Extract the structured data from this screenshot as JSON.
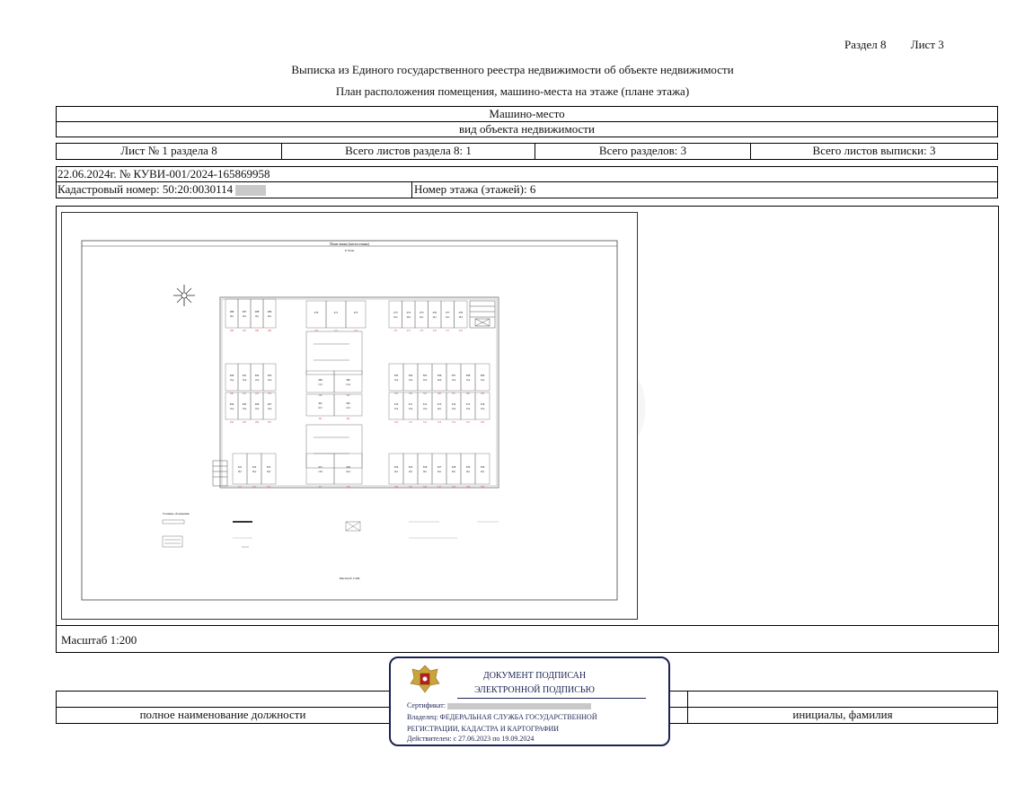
{
  "header": {
    "section": "Раздел 8",
    "sheet": "Лист 3",
    "title": "Выписка из Единого государственного реестра недвижимости об объекте недвижимости",
    "subtitle": "План расположения помещения, машино-места на этаже (плане этажа)"
  },
  "object": {
    "name": "Машино-место",
    "caption": "вид объекта недвижимости"
  },
  "sheets": {
    "sheet_no": "Лист № 1 раздела 8",
    "total_section_sheets": "Всего листов раздела 8: 1",
    "total_sections": "Всего разделов: 3",
    "total_extract_sheets": "Всего листов выписки: 3"
  },
  "record": {
    "date_number": "22.06.2024г. № КУВИ-001/2024-165869958",
    "cadastral_label": "Кадастровый номер: 50:20:0030114",
    "floor": "Номер этажа (этажей): 6"
  },
  "plan": {
    "sheet_title": "План этажа (части этажа)",
    "sheet_subtitle": "6 Этаж",
    "sheet_scale": "Масштаб 1:200",
    "legend_title": "Условные обозначения:",
    "top_left_ids": [
      "286",
      "287",
      "288",
      "289"
    ],
    "top_left_areas": [
      "16,1",
      "16,1",
      "16,1",
      "16,1"
    ],
    "top_mid_ids": [
      "270",
      "271",
      "272"
    ],
    "top_right_ids": [
      "273",
      "274",
      "275",
      "276",
      "277",
      "278"
    ],
    "top_right_areas": [
      "16,2",
      "16,2",
      "16,1",
      "16,1",
      "16,1",
      "16,2"
    ],
    "mid_left_ids": [
      "290",
      "291",
      "292",
      "293"
    ],
    "mid_left_areas": [
      "13,4",
      "13,4",
      "13,4",
      "13,4"
    ],
    "low_left_ids": [
      "294",
      "295",
      "296",
      "297"
    ],
    "low_left_areas": [
      "13,4",
      "13,4",
      "13,4",
      "13,4"
    ],
    "mid_center_ids": [
      "299",
      "300",
      "301",
      "302"
    ],
    "mid_center_areas": [
      "13,5",
      "15,4",
      "16,7",
      "13,5"
    ],
    "mid_right_ids": [
      "303",
      "304",
      "305",
      "306",
      "307",
      "308",
      "309"
    ],
    "mid_right_areas": [
      "15,4",
      "15,4",
      "15,4",
      "16,0",
      "15,4",
      "15,4",
      "15,4"
    ],
    "low_right_ids": [
      "310",
      "311",
      "312",
      "313",
      "314",
      "315",
      "316"
    ],
    "low_right_areas": [
      "15,4",
      "15,4",
      "15,4",
      "16,1",
      "15,4",
      "15,4",
      "15,4"
    ],
    "bottom_left_ids": [
      "321",
      "322",
      "323"
    ],
    "bottom_left_areas": [
      "16,7",
      "16,2",
      "16,2"
    ],
    "bottom_center_ids": [
      "317",
      "318"
    ],
    "bottom_center_areas": [
      "13,9",
      "16,4"
    ],
    "bottom_right_ids": [
      "324",
      "325",
      "326",
      "327",
      "328",
      "329",
      "330"
    ],
    "bottom_right_areas": [
      "16,1",
      "16,1",
      "16,1",
      "16,1",
      "16,1",
      "16,1",
      "16,1"
    ]
  },
  "scale": "Масштаб 1:200",
  "signature": {
    "position": "полное наименование должности",
    "name": "инициалы, фамилия"
  },
  "stamp": {
    "line1": "ДОКУМЕНТ ПОДПИСАН",
    "line2": "ЭЛЕКТРОННОЙ ПОДПИСЬЮ",
    "cert_label": "Сертификат:",
    "owner": "Владелец: ФЕДЕРАЛЬНАЯ СЛУЖБА ГОСУДАРСТВЕННОЙ",
    "owner2": "РЕГИСТРАЦИИ, КАДАСТРА И КАРТОГРАФИИ",
    "valid": "Действителен: с 27.06.2023 по 19.09.2024"
  },
  "watermark": "Avito",
  "colors": {
    "ink": "#111111",
    "stamp": "#1b2353",
    "redaction": "#c9c9c9",
    "plan_red": "#d13a3a"
  }
}
